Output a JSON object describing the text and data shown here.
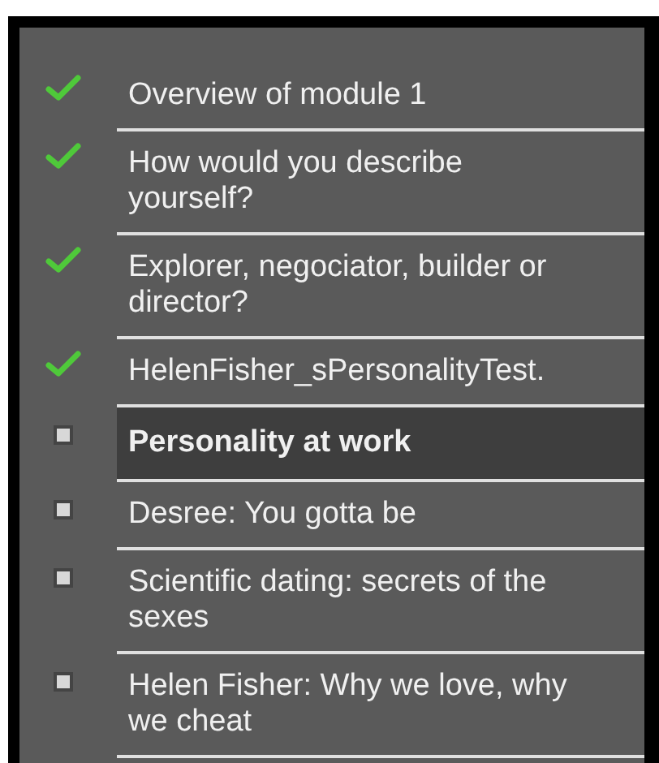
{
  "items": [
    {
      "label": "Overview of module 1",
      "kind": "done",
      "selected": false
    },
    {
      "label": "How would you describe yourself?",
      "kind": "done",
      "selected": false
    },
    {
      "label": "Explorer, negociator, builder or director?",
      "kind": "done",
      "selected": false
    },
    {
      "label": "HelenFisher_sPersonalityTest.",
      "kind": "done",
      "selected": false
    },
    {
      "label": "Personality at work",
      "kind": "pending",
      "selected": true
    },
    {
      "label": "Desree: You gotta be",
      "kind": "pending",
      "selected": false
    },
    {
      "label": "Scientific dating: secrets of the sexes",
      "kind": "pending",
      "selected": false
    },
    {
      "label": "Helen Fisher: Why we love, why we cheat",
      "kind": "pending",
      "selected": false
    }
  ]
}
